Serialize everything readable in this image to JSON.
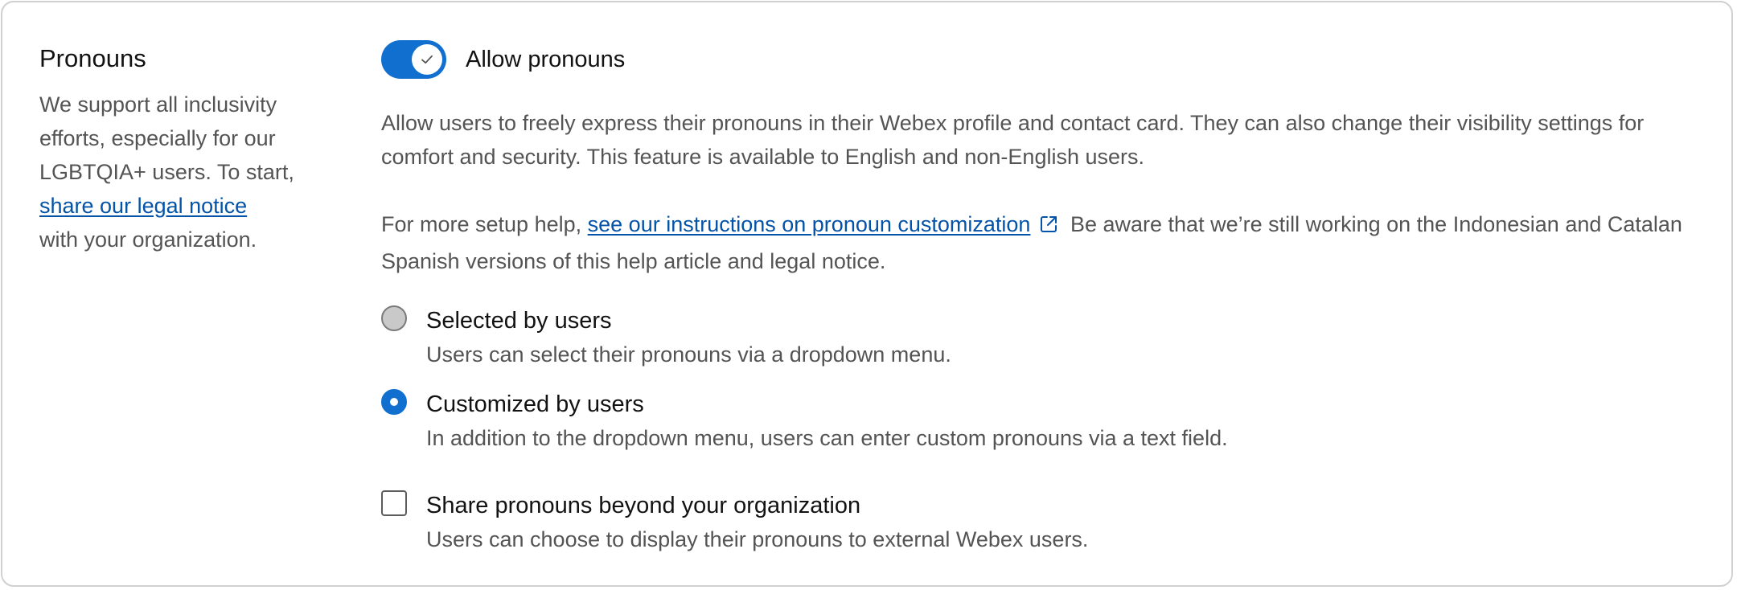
{
  "section": {
    "title": "Pronouns",
    "description_before_link": "We support all inclusivity efforts, especially for our LGBTQIA+ users. To start,",
    "link_text": "share our legal notice",
    "description_after_link": "with your organization."
  },
  "toggle": {
    "label": "Allow pronouns",
    "state": "on"
  },
  "intro_text": "Allow users to freely express their pronouns in their Webex profile and contact card. They can also change their visibility settings for comfort and security. This feature is available to English and non-English users.",
  "help": {
    "prefix": "For more setup help,",
    "link_text": "see our instructions on pronoun customization",
    "suffix": "Be aware that we’re still working on the Indonesian and Catalan Spanish versions of this help article and legal notice."
  },
  "options": {
    "selected": {
      "label": "Selected by users",
      "help": "Users can select their pronouns via a dropdown menu.",
      "checked": false
    },
    "customized": {
      "label": "Customized by users",
      "help": "In addition to the dropdown menu, users can enter custom pronouns via a text field.",
      "checked": true
    }
  },
  "share": {
    "label": "Share pronouns beyond your organization",
    "help": "Users can choose to display their pronouns to external Webex users.",
    "checked": false
  },
  "colors": {
    "accent": "#1170cf",
    "link": "#0353a8",
    "text_primary": "#121212",
    "text_secondary": "#545454",
    "border": "#d0d0d0"
  },
  "icons": {
    "toggle_knob": "checkmark-icon",
    "external_link": "external-link-icon"
  }
}
